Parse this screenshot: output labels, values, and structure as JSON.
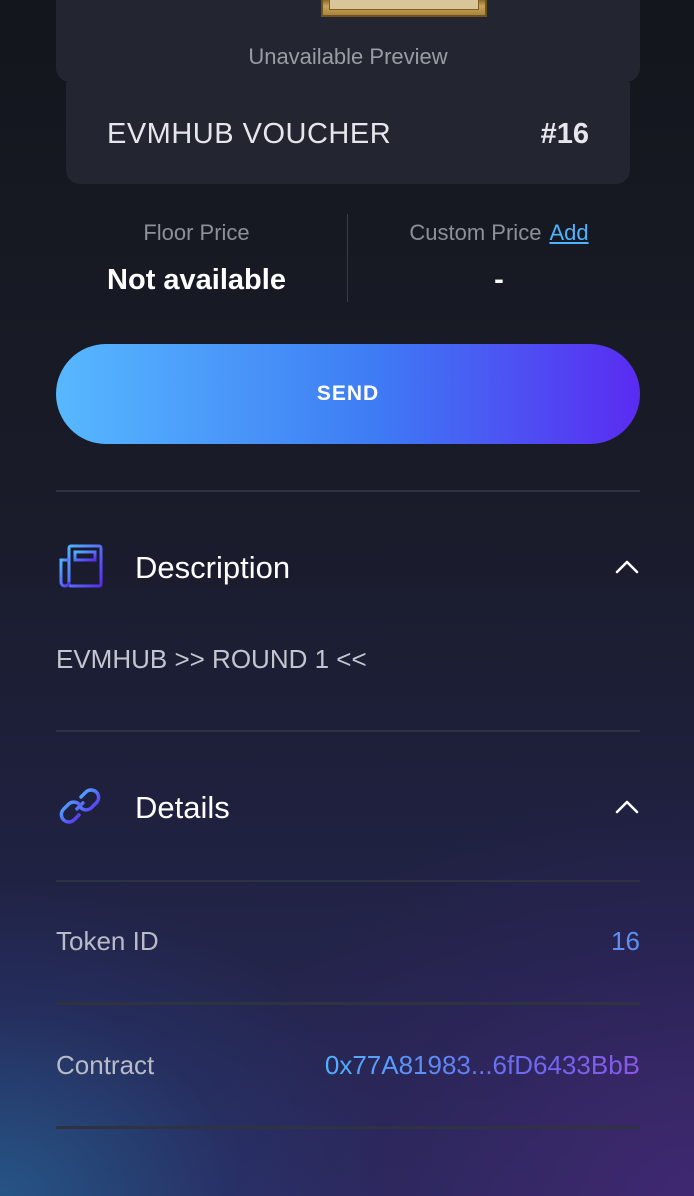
{
  "preview": {
    "label": "Unavailable Preview"
  },
  "nft": {
    "name": "EVMHUB VOUCHER",
    "number": "#16"
  },
  "pricing": {
    "floor_label": "Floor Price",
    "floor_value": "Not available",
    "custom_label": "Custom Price",
    "custom_action": "Add",
    "custom_value": "-"
  },
  "actions": {
    "send_label": "SEND"
  },
  "description": {
    "title": "Description",
    "icon": "newspaper-icon",
    "text": "EVMHUB >> ROUND 1 <<"
  },
  "details": {
    "title": "Details",
    "icon": "link-icon",
    "rows": [
      {
        "label": "Token ID",
        "value": "16"
      },
      {
        "label": "Contract",
        "value": "0x77A81983...6fD6433BbB"
      }
    ]
  },
  "colors": {
    "accent_blue": "#4fb3ff",
    "accent_purple": "#5a2bf2",
    "card_bg": "#232530"
  }
}
